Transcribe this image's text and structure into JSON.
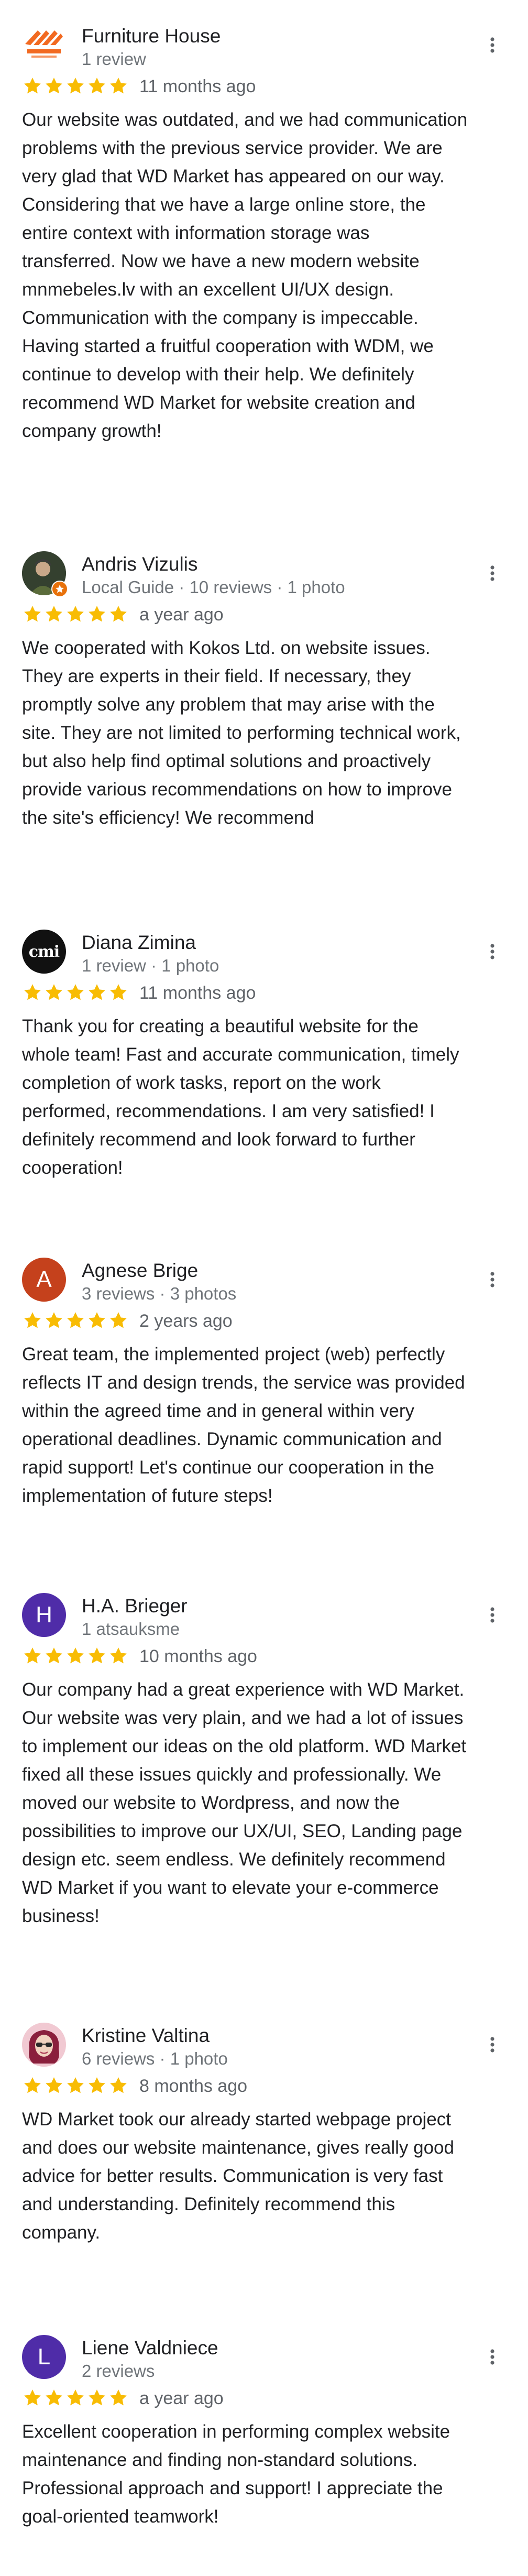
{
  "colors": {
    "star": "#f8bc04",
    "meta_text": "#70757a",
    "body_text": "#202124"
  },
  "reviews": [
    {
      "name": "Furniture House",
      "meta": "1 review",
      "rating": 5,
      "date": "11 months ago",
      "avatar": {
        "type": "logo",
        "icon": "furniture-house-logo"
      },
      "text": "Our website was outdated, and we had communication\nproblems with the previous service provider. We are\nvery glad that WD Market has appeared on our way.\nConsidering that we have a large online store, the\nentire context with information storage was\ntransferred. Now we have a new modern website\nmnmebeles.lv with an excellent UI/UX design.\nCommunication with the company is impeccable.\nHaving started a fruitful cooperation with WDM, we\ncontinue to develop with their help. We definitely\nrecommend WD Market for website creation and\ncompany growth!"
    },
    {
      "name": "Andris Vizulis",
      "meta": "Local Guide · 10 reviews · 1 photo",
      "rating": 5,
      "date": "a year ago",
      "avatar": {
        "type": "photo",
        "icon": "user-photo-avatar",
        "badge": "local-guide-badge-icon"
      },
      "text": "We cooperated with Kokos Ltd. on website issues.\nThey are experts in their field. If necessary, they\npromptly solve any problem that may arise with the\nsite. They are not limited to performing technical work,\nbut also help find optimal solutions and proactively\nprovide various recommendations on how to improve\nthe site's efficiency! We recommend"
    },
    {
      "name": "Diana Zimina",
      "meta": "1 review · 1 photo",
      "rating": 5,
      "date": "11 months ago",
      "avatar": {
        "type": "logo",
        "icon": "cmi-logo",
        "logo_text": "cmi"
      },
      "text": "Thank you for creating a beautiful website for the\nwhole team! Fast and accurate communication, timely\ncompletion of work tasks, report on the work\nperformed, recommendations. I am very satisfied! I\ndefinitely recommend and look forward to further\ncooperation!"
    },
    {
      "name": "Agnese Brige",
      "meta": "3 reviews · 3 photos",
      "rating": 5,
      "date": "2 years ago",
      "avatar": {
        "type": "letter",
        "letter": "A",
        "color": "#c5411c"
      },
      "text": "Great team, the implemented project (web) perfectly\nreflects IT and design trends, the service was provided\nwithin the agreed time and in general within very\noperational deadlines. Dynamic communication and\nrapid support! Let's continue our cooperation in the\nimplementation of future steps!"
    },
    {
      "name": "H.A. Brieger",
      "meta": "1 atsauksme",
      "rating": 5,
      "date": "10 months ago",
      "avatar": {
        "type": "letter",
        "letter": "H",
        "color": "#4f2ca8"
      },
      "text": "Our company had a great experience with WD Market.\nOur website was very plain, and we had a lot of issues\nto implement our ideas on the old platform. WD Market\nfixed all these issues quickly and professionally. We\nmoved our website to Wordpress, and now the\npossibilities to improve our UX/UI, SEO, Landing page\ndesign etc. seem endless. We definitely recommend\nWD Market if you want to elevate your e-commerce\nbusiness!"
    },
    {
      "name": "Kristine Valtina",
      "meta": "6 reviews · 1 photo",
      "rating": 5,
      "date": "8 months ago",
      "avatar": {
        "type": "photo",
        "icon": "user-photo-avatar"
      },
      "text": "WD Market took our already started webpage project\nand does our website maintenance, gives really good\nadvice for better results. Communication is very fast\nand understanding. Definitely recommend this\ncompany."
    },
    {
      "name": "Liene Valdniece",
      "meta": "2 reviews",
      "rating": 5,
      "date": "a year ago",
      "avatar": {
        "type": "letter",
        "letter": "L",
        "color": "#4f2ca8"
      },
      "text": "Excellent cooperation in performing complex website\nmaintenance and finding non-standard solutions.\nProfessional approach and support! I appreciate the\ngoal-oriented teamwork!"
    }
  ]
}
